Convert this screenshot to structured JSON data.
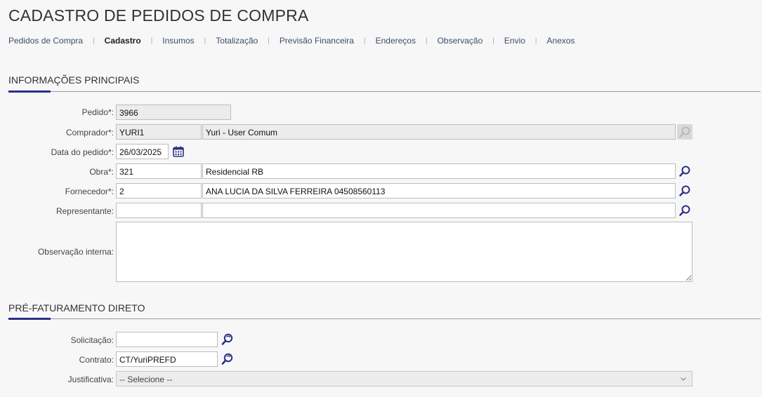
{
  "page": {
    "title": "CADASTRO DE PEDIDOS DE COMPRA"
  },
  "tabs": [
    {
      "label": "Pedidos de Compra"
    },
    {
      "label": "Cadastro"
    },
    {
      "label": "Insumos"
    },
    {
      "label": "Totalização"
    },
    {
      "label": "Previsão Financeira"
    },
    {
      "label": "Endereços"
    },
    {
      "label": "Observação"
    },
    {
      "label": "Envio"
    },
    {
      "label": "Anexos"
    }
  ],
  "active_tab": "Cadastro",
  "main_section": {
    "title": "INFORMAÇÕES PRINCIPAIS",
    "pedido": {
      "label": "Pedido*:",
      "value": "3966"
    },
    "comprador": {
      "label": "Comprador*:",
      "code": "YURI1",
      "name": "Yuri - User Comum"
    },
    "data_pedido": {
      "label": "Data do pedido*:",
      "value": "26/03/2025"
    },
    "obra": {
      "label": "Obra*:",
      "code": "321",
      "name": "Residencial RB"
    },
    "fornecedor": {
      "label": "Fornecedor*:",
      "code": "2",
      "name": "ANA LUCIA DA SILVA FERREIRA 04508560113"
    },
    "representante": {
      "label": "Representante:",
      "code": "",
      "name": ""
    },
    "observacao_interna": {
      "label": "Observação interna:",
      "value": ""
    }
  },
  "pre_faturamento": {
    "title": "PRÉ-FATURAMENTO DIRETO",
    "solicitacao": {
      "label": "Solicitação:",
      "value": ""
    },
    "contrato": {
      "label": "Contrato:",
      "value": "CT/YuriPREFD"
    },
    "justificativa": {
      "label": "Justificativa:",
      "selected": "-- Selecione --"
    }
  },
  "colors": {
    "accent": "#2b2f86",
    "link": "#3d4d66",
    "icon": "#2b2f86"
  },
  "icons": [
    "search-icon",
    "calendar-icon",
    "search-refresh-icon",
    "chevron-down-icon"
  ]
}
